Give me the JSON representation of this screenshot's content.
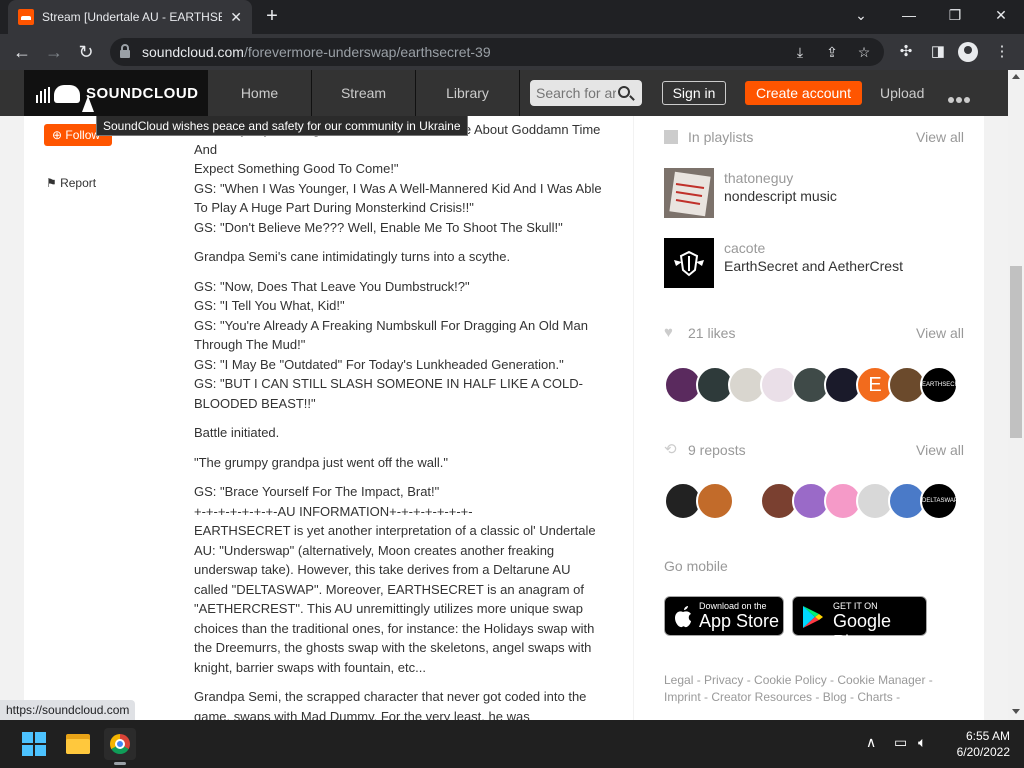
{
  "browser": {
    "tab_title": "Stream [Undertale AU - EARTHSE",
    "url_host": "soundcloud.com",
    "url_path": "/forevermore-underswap/earthsecret-39",
    "status_url": "https://soundcloud.com"
  },
  "header": {
    "logo_text": "SOUNDCLOUD",
    "nav": [
      "Home",
      "Stream",
      "Library"
    ],
    "search_placeholder": "Search for ar",
    "signin": "Sign in",
    "create_account": "Create account",
    "upload": "Upload"
  },
  "left": {
    "follow": "Follow",
    "report": "Report",
    "tooltip": "SoundCloud wishes peace and safety for our community in Ukraine"
  },
  "description": {
    "p1": "GS: \"Anyways, Youngsters Like You Never Care About Goddamn Time And\nExpect Something Good To Come!\"\nGS: \"When I Was Younger, I Was A Well-Mannered Kid And I Was Able To Play A Huge Part During Monsterkind Crisis!!\"\nGS: \"Don't Believe Me??? Well, Enable Me To Shoot The Skull!\"",
    "p2": "Grandpa Semi's cane intimidatingly turns into a scythe.",
    "p3": "GS: \"Now, Does That Leave You Dumbstruck!?\"\nGS: \"I Tell You What, Kid!\"\nGS: \"You're Already A Freaking Numbskull For Dragging An Old Man Through The Mud!\"\nGS: \"I May Be \"Outdated\" For Today's Lunkheaded Generation.\"\nGS: \"BUT I CAN STILL SLASH SOMEONE IN HALF LIKE A COLD-BLOODED BEAST!!\"",
    "p4": "Battle initiated.",
    "p5": "\"The grumpy grandpa just went off the wall.\"",
    "p6": "GS: \"Brace Yourself For The Impact, Brat!\"\n+-+-+-+-+-+-+-AU INFORMATION+-+-+-+-+-+-+-\nEARTHSECRET is yet another interpretation of a classic ol' Undertale AU: \"Underswap\" (alternatively, Moon creates another freaking underswap take). However, this take derives from a Deltarune AU called \"DELTASWAP\". Moreover, EARTHSECRET is an anagram of \"AETHERCREST\". This AU unremittingly utilizes more unique swap choices than the traditional ones, for instance: the Holidays swap with the Dreemurrs, the ghosts swap with the skeletons, angel swaps with knight, barrier swaps with fountain, etc...",
    "p7": "Grandpa Semi, the scrapped character that never got coded into the game, swaps with Mad Dummy. For the very least, he was"
  },
  "sidebar": {
    "in_playlists": "In playlists",
    "view_all": "View all",
    "playlists": [
      {
        "user": "thatoneguy",
        "title": "nondescript music"
      },
      {
        "user": "cacote",
        "title": "EarthSecret and AetherCrest"
      }
    ],
    "likes": "21 likes",
    "reposts": "9 reposts",
    "go_mobile": "Go mobile",
    "app_store_small": "Download on the",
    "app_store_big": "App Store",
    "google_small": "GET IT ON",
    "google_big": "Google Play",
    "footer": "Legal - Privacy - Cookie Policy - Cookie Manager - Imprint - Creator Resources - Blog - Charts -"
  },
  "taskbar": {
    "time": "6:55 AM",
    "date": "6/20/2022"
  },
  "colors": {
    "accent": "#ff5500",
    "header_bg": "#333333"
  }
}
